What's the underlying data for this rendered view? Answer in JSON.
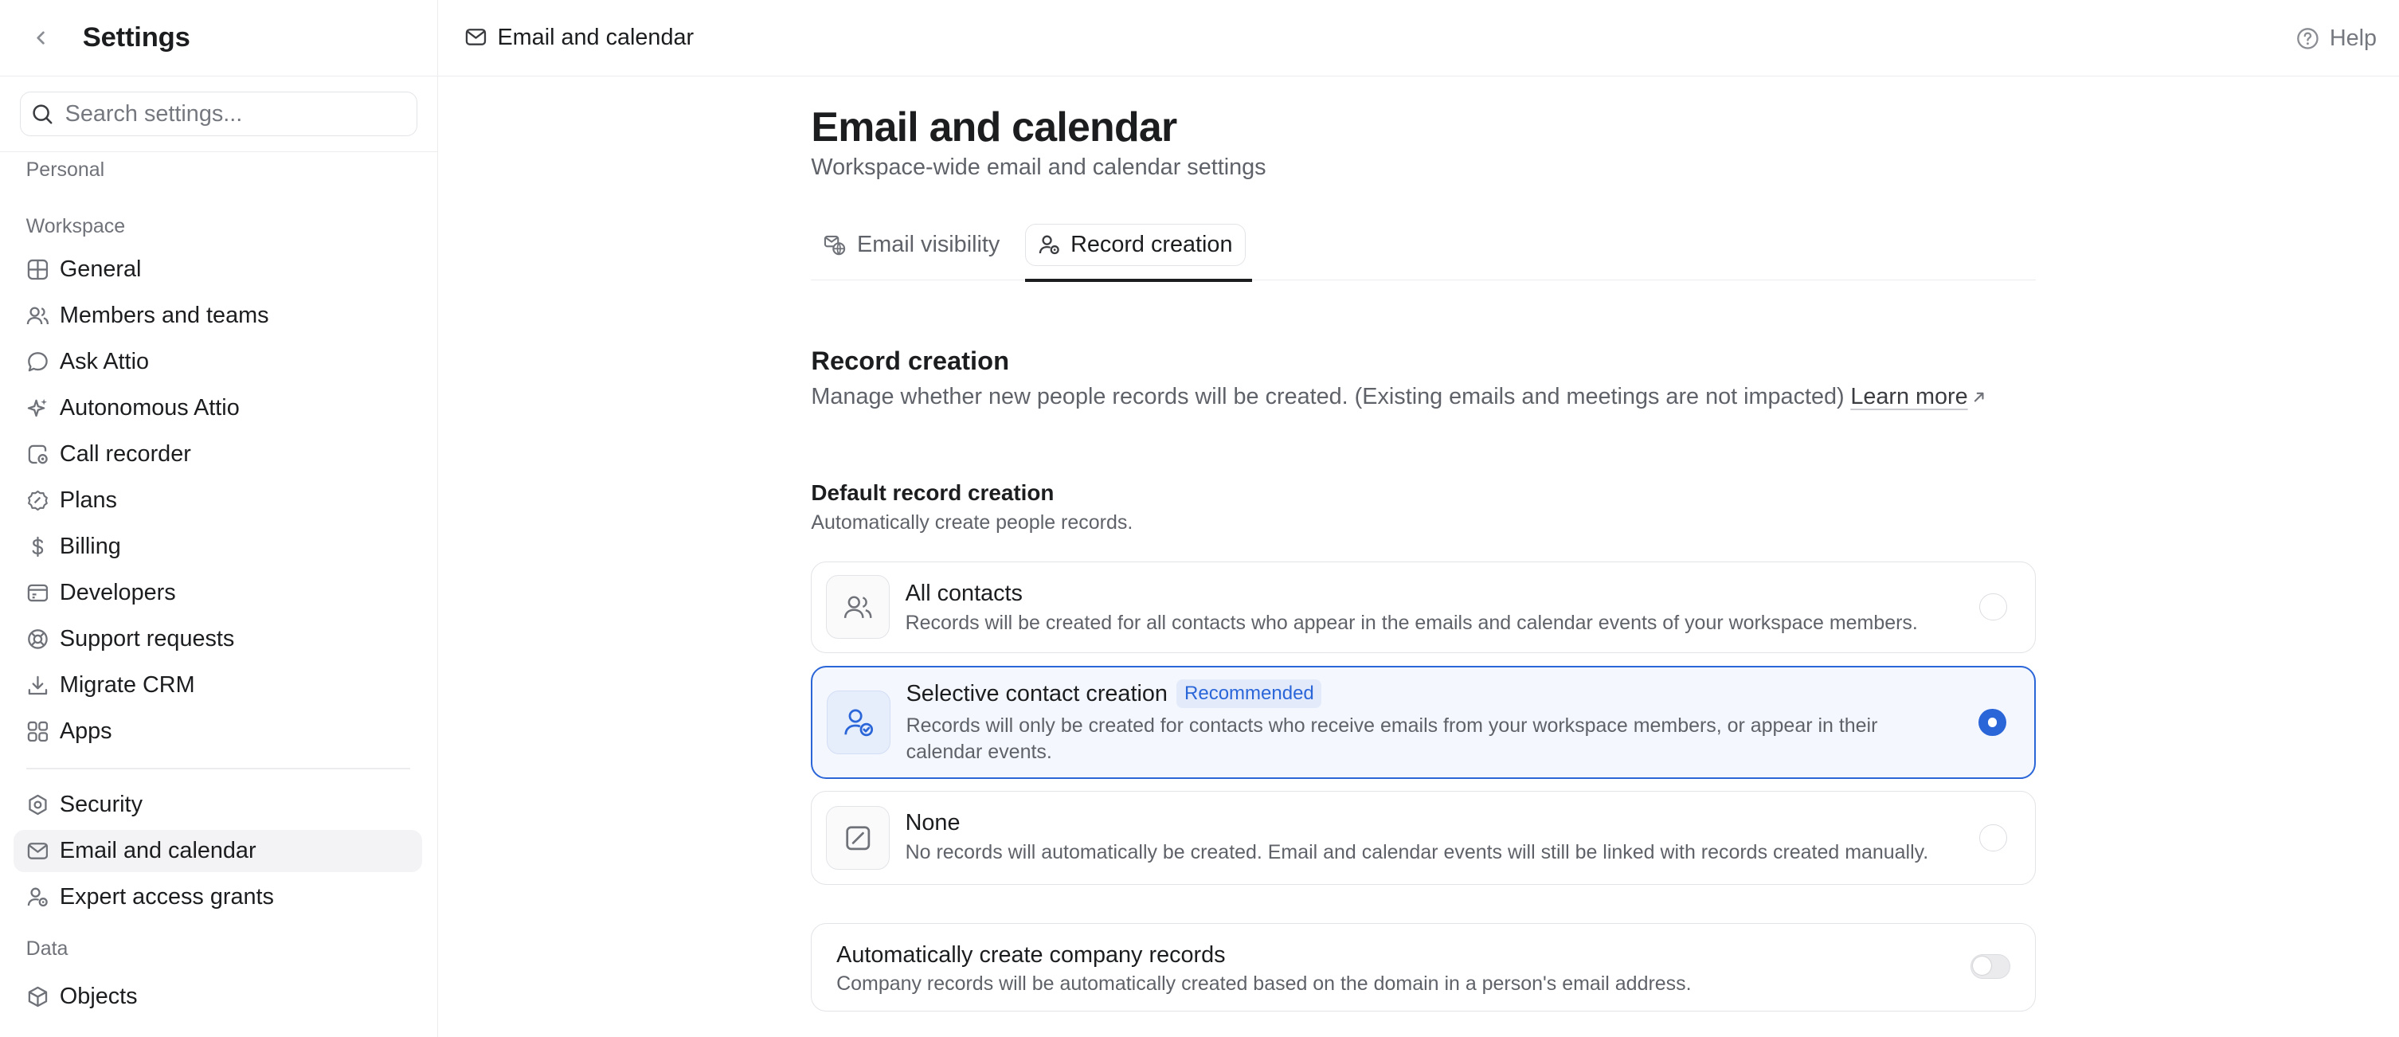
{
  "sidebar": {
    "title": "Settings",
    "search_placeholder": "Search settings...",
    "sections": {
      "personal": "Personal",
      "workspace": "Workspace",
      "data": "Data"
    },
    "workspace_items": [
      {
        "label": "General",
        "icon": "grid-icon"
      },
      {
        "label": "Members and teams",
        "icon": "users-icon"
      },
      {
        "label": "Ask Attio",
        "icon": "chat-bubble-icon"
      },
      {
        "label": "Autonomous Attio",
        "icon": "sparkle-icon"
      },
      {
        "label": "Call recorder",
        "icon": "call-recorder-icon"
      },
      {
        "label": "Plans",
        "icon": "plans-badge-icon"
      },
      {
        "label": "Billing",
        "icon": "dollar-icon"
      },
      {
        "label": "Developers",
        "icon": "developer-card-icon"
      },
      {
        "label": "Support requests",
        "icon": "support-icon"
      },
      {
        "label": "Migrate CRM",
        "icon": "download-icon"
      },
      {
        "label": "Apps",
        "icon": "apps-icon"
      }
    ],
    "security_items": [
      {
        "label": "Security",
        "icon": "shield-icon"
      },
      {
        "label": "Email and calendar",
        "icon": "mail-icon",
        "active": true
      },
      {
        "label": "Expert access grants",
        "icon": "user-key-icon"
      }
    ],
    "data_items": [
      {
        "label": "Objects",
        "icon": "cube-icon"
      }
    ]
  },
  "topbar": {
    "breadcrumb": "Email and calendar",
    "help_label": "Help"
  },
  "page": {
    "title": "Email and calendar",
    "subtitle": "Workspace-wide email and calendar settings",
    "tabs": [
      {
        "label": "Email visibility",
        "active": false
      },
      {
        "label": "Record creation",
        "active": true
      }
    ]
  },
  "record_creation": {
    "title": "Record creation",
    "description": "Manage whether new people records will be created. (Existing emails and meetings are not impacted)",
    "learn_more": "Learn more",
    "default_title": "Default record creation",
    "default_desc": "Automatically create people records.",
    "options": [
      {
        "title": "All contacts",
        "badge": "",
        "desc": "Records will be created for all contacts who appear in the emails and calendar events of your workspace members.",
        "selected": false
      },
      {
        "title": "Selective contact creation",
        "badge": "Recommended",
        "desc": "Records will only be created for contacts who receive emails from your workspace members, or appear in their calendar events.",
        "selected": true
      },
      {
        "title": "None",
        "badge": "",
        "desc": "No records will automatically be created. Email and calendar events will still be linked with records created manually.",
        "selected": false
      }
    ],
    "company": {
      "title": "Automatically create company records",
      "desc": "Company records will be automatically created based on the domain in a person's email address.",
      "enabled": false
    }
  },
  "colors": {
    "accent": "#2b66d9",
    "active_item_bg": "#f3f3f5",
    "border": "#e3e4e7"
  }
}
